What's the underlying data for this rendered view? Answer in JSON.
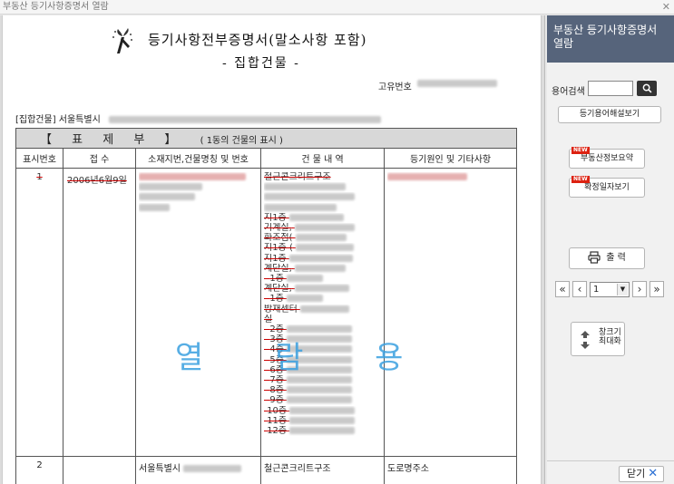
{
  "window": {
    "title": "부동산 등기사항증명서 열람",
    "close_glyph": "✕"
  },
  "document": {
    "title": "등기사항전부증명서(말소사항 포함)",
    "subtitle": "- 집합건물 -",
    "unique_no_label": "고유번호",
    "building_prefix": "[집합건물] 서울특별시",
    "section_title": "【 표 제 부 】",
    "section_note": "( 1동의 건물의 표시 )",
    "columns": [
      "표시번호",
      "접 수",
      "소재지번,건물명칭 및 번호",
      "건 물 내 역",
      "등기원인 및 기타사항"
    ],
    "rows": [
      {
        "no": "1",
        "receipt": "2006년6월9일",
        "details": [
          "철근콘크리트구조",
          "지1층",
          "기계실,",
          "화조점(",
          "지1층 (",
          "지1층",
          "계단실,",
          "1층",
          "계단실,",
          "1층",
          "방재센터",
          "실",
          "2층",
          "3층",
          "4층",
          "5층",
          "6층",
          "7층",
          "8층",
          "9층",
          "10층",
          "11층",
          "12층"
        ]
      },
      {
        "no": "2",
        "receipt": "",
        "location": "서울특별시",
        "details": [
          "철근콘크리트구조"
        ],
        "cause": "도로명주소"
      }
    ],
    "watermark": "열 람 용"
  },
  "sidebar": {
    "title": "부동산 등기사항증명서 열람",
    "search_label": "용어검색",
    "search_value": "",
    "glossary_button": "등기용어해설보기",
    "summary_button": "부동산정보요약",
    "confirm_date_button": "확정일자보기",
    "new_badge": "NEW",
    "print_button": "출 력",
    "page_value": "1",
    "maximize_button": "창크기 최대화",
    "close_button": "닫기"
  }
}
